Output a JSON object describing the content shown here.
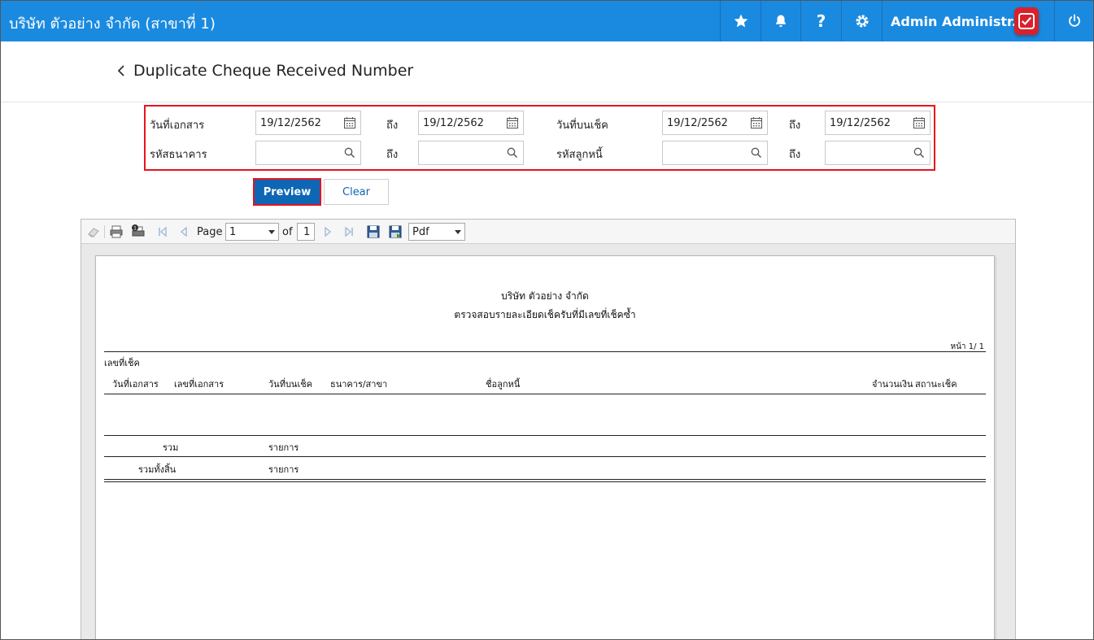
{
  "header": {
    "company": "บริษัท ตัวอย่าง จำกัด (สาขาที่ 1)",
    "user": "Admin Administr...",
    "icons": [
      "star-icon",
      "bell-icon",
      "help-icon",
      "gear-icon",
      "app-badge-icon",
      "power-icon"
    ],
    "help_label": "?",
    "bar_color": "#1a8ae0"
  },
  "page": {
    "title": "Duplicate Cheque Received Number"
  },
  "filters": {
    "doc_date_label": "วันที่เอกสาร",
    "doc_date_from": "19/12/2562",
    "to1": "ถึง",
    "doc_date_to": "19/12/2562",
    "cheque_date_label": "วันที่บนเช็ค",
    "cheque_date_from": "19/12/2562",
    "to2": "ถึง",
    "cheque_date_to": "19/12/2562",
    "bank_code_label": "รหัสธนาคาร",
    "bank_code_from": "",
    "to3": "ถึง",
    "bank_code_to": "",
    "debtor_code_label": "รหัสลูกหนี้",
    "debtor_code_from": "",
    "to4": "ถึง",
    "debtor_code_to": ""
  },
  "buttons": {
    "preview": "Preview",
    "clear": "Clear"
  },
  "viewer": {
    "page_label": "Page",
    "page_value": "1",
    "of_label": "of",
    "total_pages": "1",
    "format": "Pdf"
  },
  "report": {
    "company": "บริษัท ตัวอย่าง จำกัด",
    "title": "ตรวจสอบรายละเอียดเช็ครับที่มีเลขที่เช็คซ้ำ",
    "page_no": "หน้า 1/ 1",
    "col_cheque_no": "เลขที่เช็ค",
    "col_doc_date": "วันที่เอกสาร",
    "col_doc_no": "เลขที่เอกสาร",
    "col_cheque_date": "วันที่บนเช็ค",
    "col_bank": "ธนาคาร/สาขา",
    "col_debtor": "ชื่อลูกหนี้",
    "col_amount": "จำนวนเงิน",
    "col_status": "สถานะเช็ค",
    "total_label": "รวม",
    "total_unit": "รายการ",
    "grand_total_label": "รวมทั้งสิ้น",
    "grand_total_unit": "รายการ"
  }
}
